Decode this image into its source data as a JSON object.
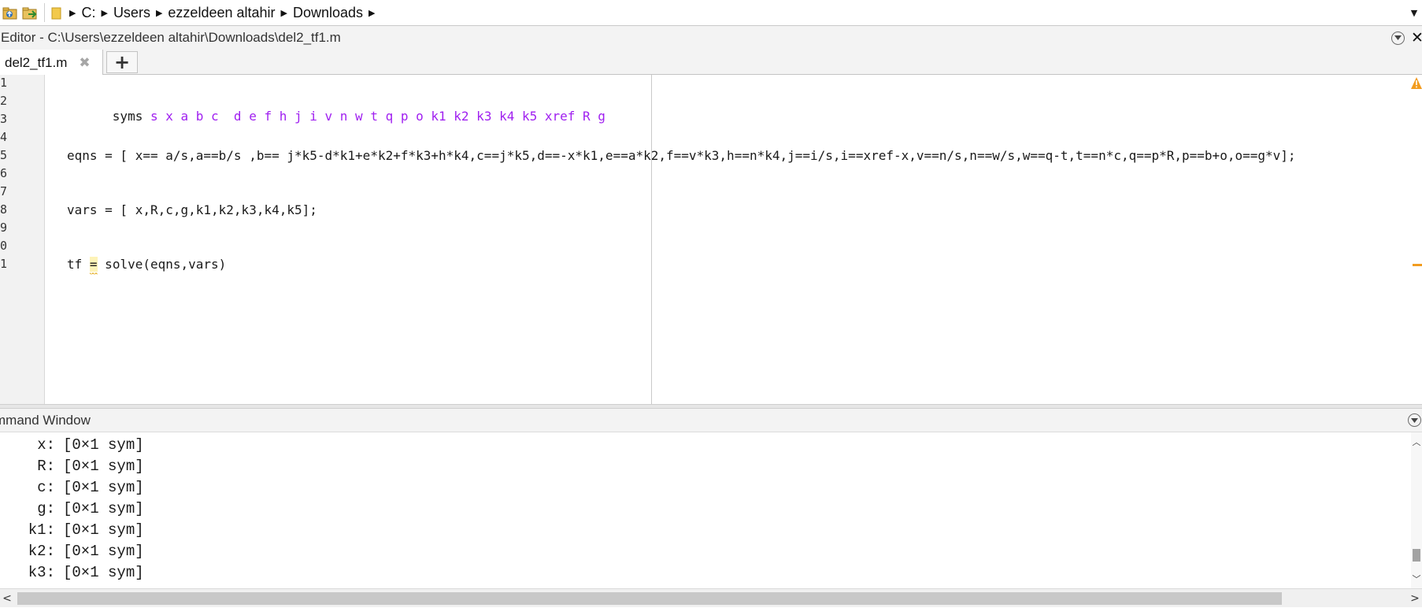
{
  "address_bar": {
    "crumbs": [
      "C:",
      "Users",
      "ezzeldeen altahir",
      "Downloads"
    ],
    "icons": [
      "folder-up-icon",
      "browse-folder-icon",
      "folder-icon",
      "dropdown-icon"
    ]
  },
  "editor": {
    "title": "Editor - C:\\Users\\ezzeldeen altahir\\Downloads\\del2_tf1.m",
    "tabs": [
      {
        "label": "del2_tf1.m",
        "active": true
      }
    ],
    "line_numbers": [
      "1",
      "2",
      "3",
      "4",
      "5",
      "6",
      "7",
      "8",
      "9",
      "0",
      "1"
    ],
    "code": {
      "line2_keyword": "syms",
      "line2_args": "s x a b c  d e f h j i v n w t q p o k1 k2 k3 k4 k5 xref R g",
      "line5": "eqns = [ x== a/s,a==b/s ,b== j*k5-d*k1+e*k2+f*k3+h*k4,c==j*k5,d==-x*k1,e==a*k2,f==v*k3,h==n*k4,j==i/s,i==xref-x,v==n/s,n==w/s,w==q-t,t==n*c,q==p*R,p==b+o,o==g*v];",
      "line8": "vars = [ x,R,c,g,k1,k2,k3,k4,k5];",
      "line11_pre": "tf ",
      "line11_eq": "=",
      "line11_post": " solve(eqns,vars)"
    },
    "warning_color": "#f29c1f",
    "symbol_color": "#a020f0"
  },
  "command_window": {
    "title": "mmand Window",
    "output": [
      {
        "name": "x:",
        "value": "[0×1 sym]"
      },
      {
        "name": "R:",
        "value": "[0×1 sym]"
      },
      {
        "name": "c:",
        "value": "[0×1 sym]"
      },
      {
        "name": "g:",
        "value": "[0×1 sym]"
      },
      {
        "name": "k1:",
        "value": "[0×1 sym]"
      },
      {
        "name": "k2:",
        "value": "[0×1 sym]"
      },
      {
        "name": "k3:",
        "value": "[0×1 sym]"
      }
    ]
  }
}
